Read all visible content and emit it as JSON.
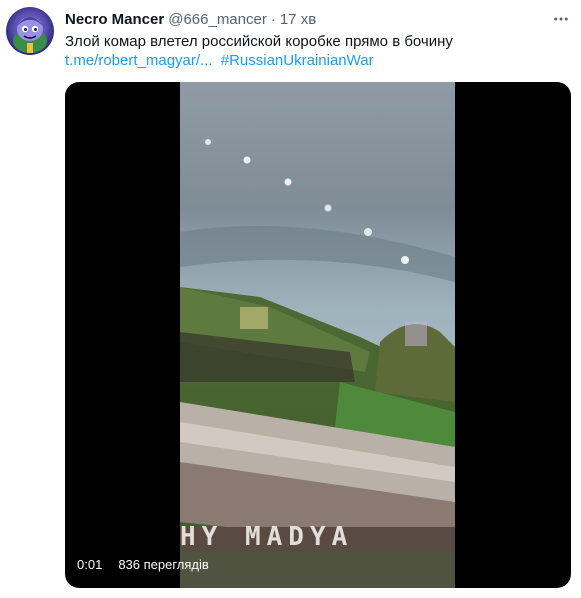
{
  "author": {
    "name": "Necro Mancer",
    "handle": "@666_mancer",
    "separator": "·",
    "time": "17 хв"
  },
  "icons": {
    "avatar": "necromancer-avatar",
    "more": "more-horizontal-icon"
  },
  "tweet": {
    "text": "Злой комар влетел российской коробке прямо в бочину",
    "link": "t.me/robert_magyar/...",
    "hashtag": "#RussianUkrainianWar"
  },
  "video": {
    "elapsed": "0:01",
    "views": "836 переглядів",
    "watermark": "HY MADYA"
  },
  "colors": {
    "text": "#0f1419",
    "secondary": "#536471",
    "link": "#1d9bf0",
    "media_background": "#000000"
  }
}
